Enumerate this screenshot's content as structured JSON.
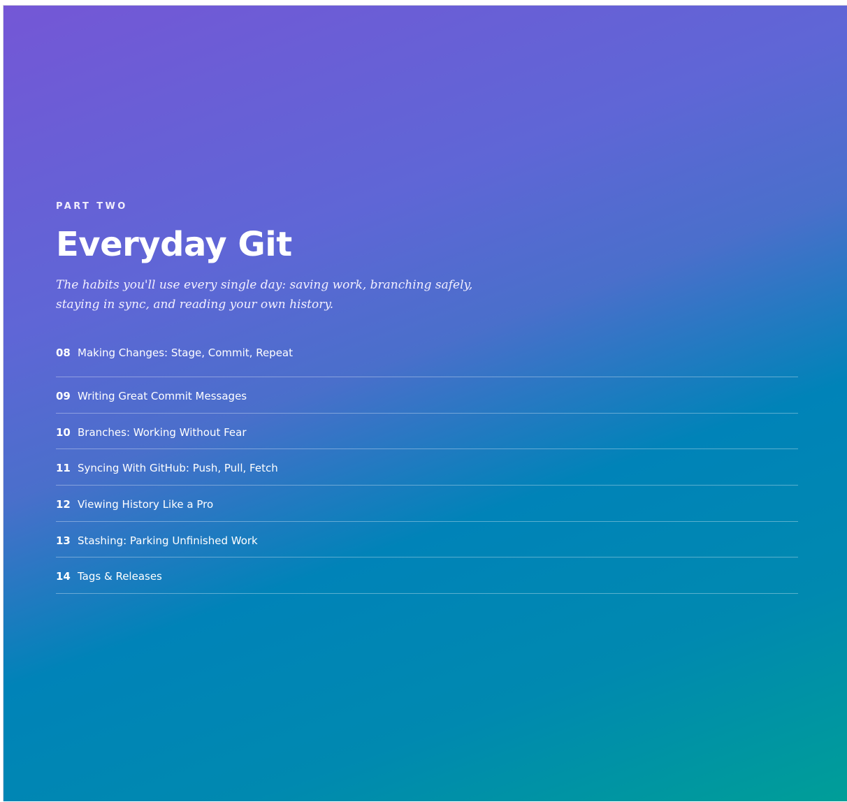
{
  "part_label": "PART TWO",
  "title": "Everyday Git",
  "subtitle": "The habits you'll use every single day: saving work, branching safely, staying in sync, and reading your own history.",
  "chapters": [
    {
      "number": "08",
      "title": "Making Changes: Stage, Commit, Repeat"
    },
    {
      "number": "09",
      "title": "Writing Great Commit Messages"
    },
    {
      "number": "10",
      "title": "Branches: Working Without Fear"
    },
    {
      "number": "11",
      "title": "Syncing With GitHub: Push, Pull, Fetch"
    },
    {
      "number": "12",
      "title": "Viewing History Like a Pro"
    },
    {
      "number": "13",
      "title": "Stashing: Parking Unfinished Work"
    },
    {
      "number": "14",
      "title": "Tags & Releases"
    }
  ],
  "colors": {
    "gradient_top": "#7457d6",
    "gradient_mid": "#0083b8",
    "gradient_bottom": "#009e98",
    "text": "#ffffff"
  }
}
